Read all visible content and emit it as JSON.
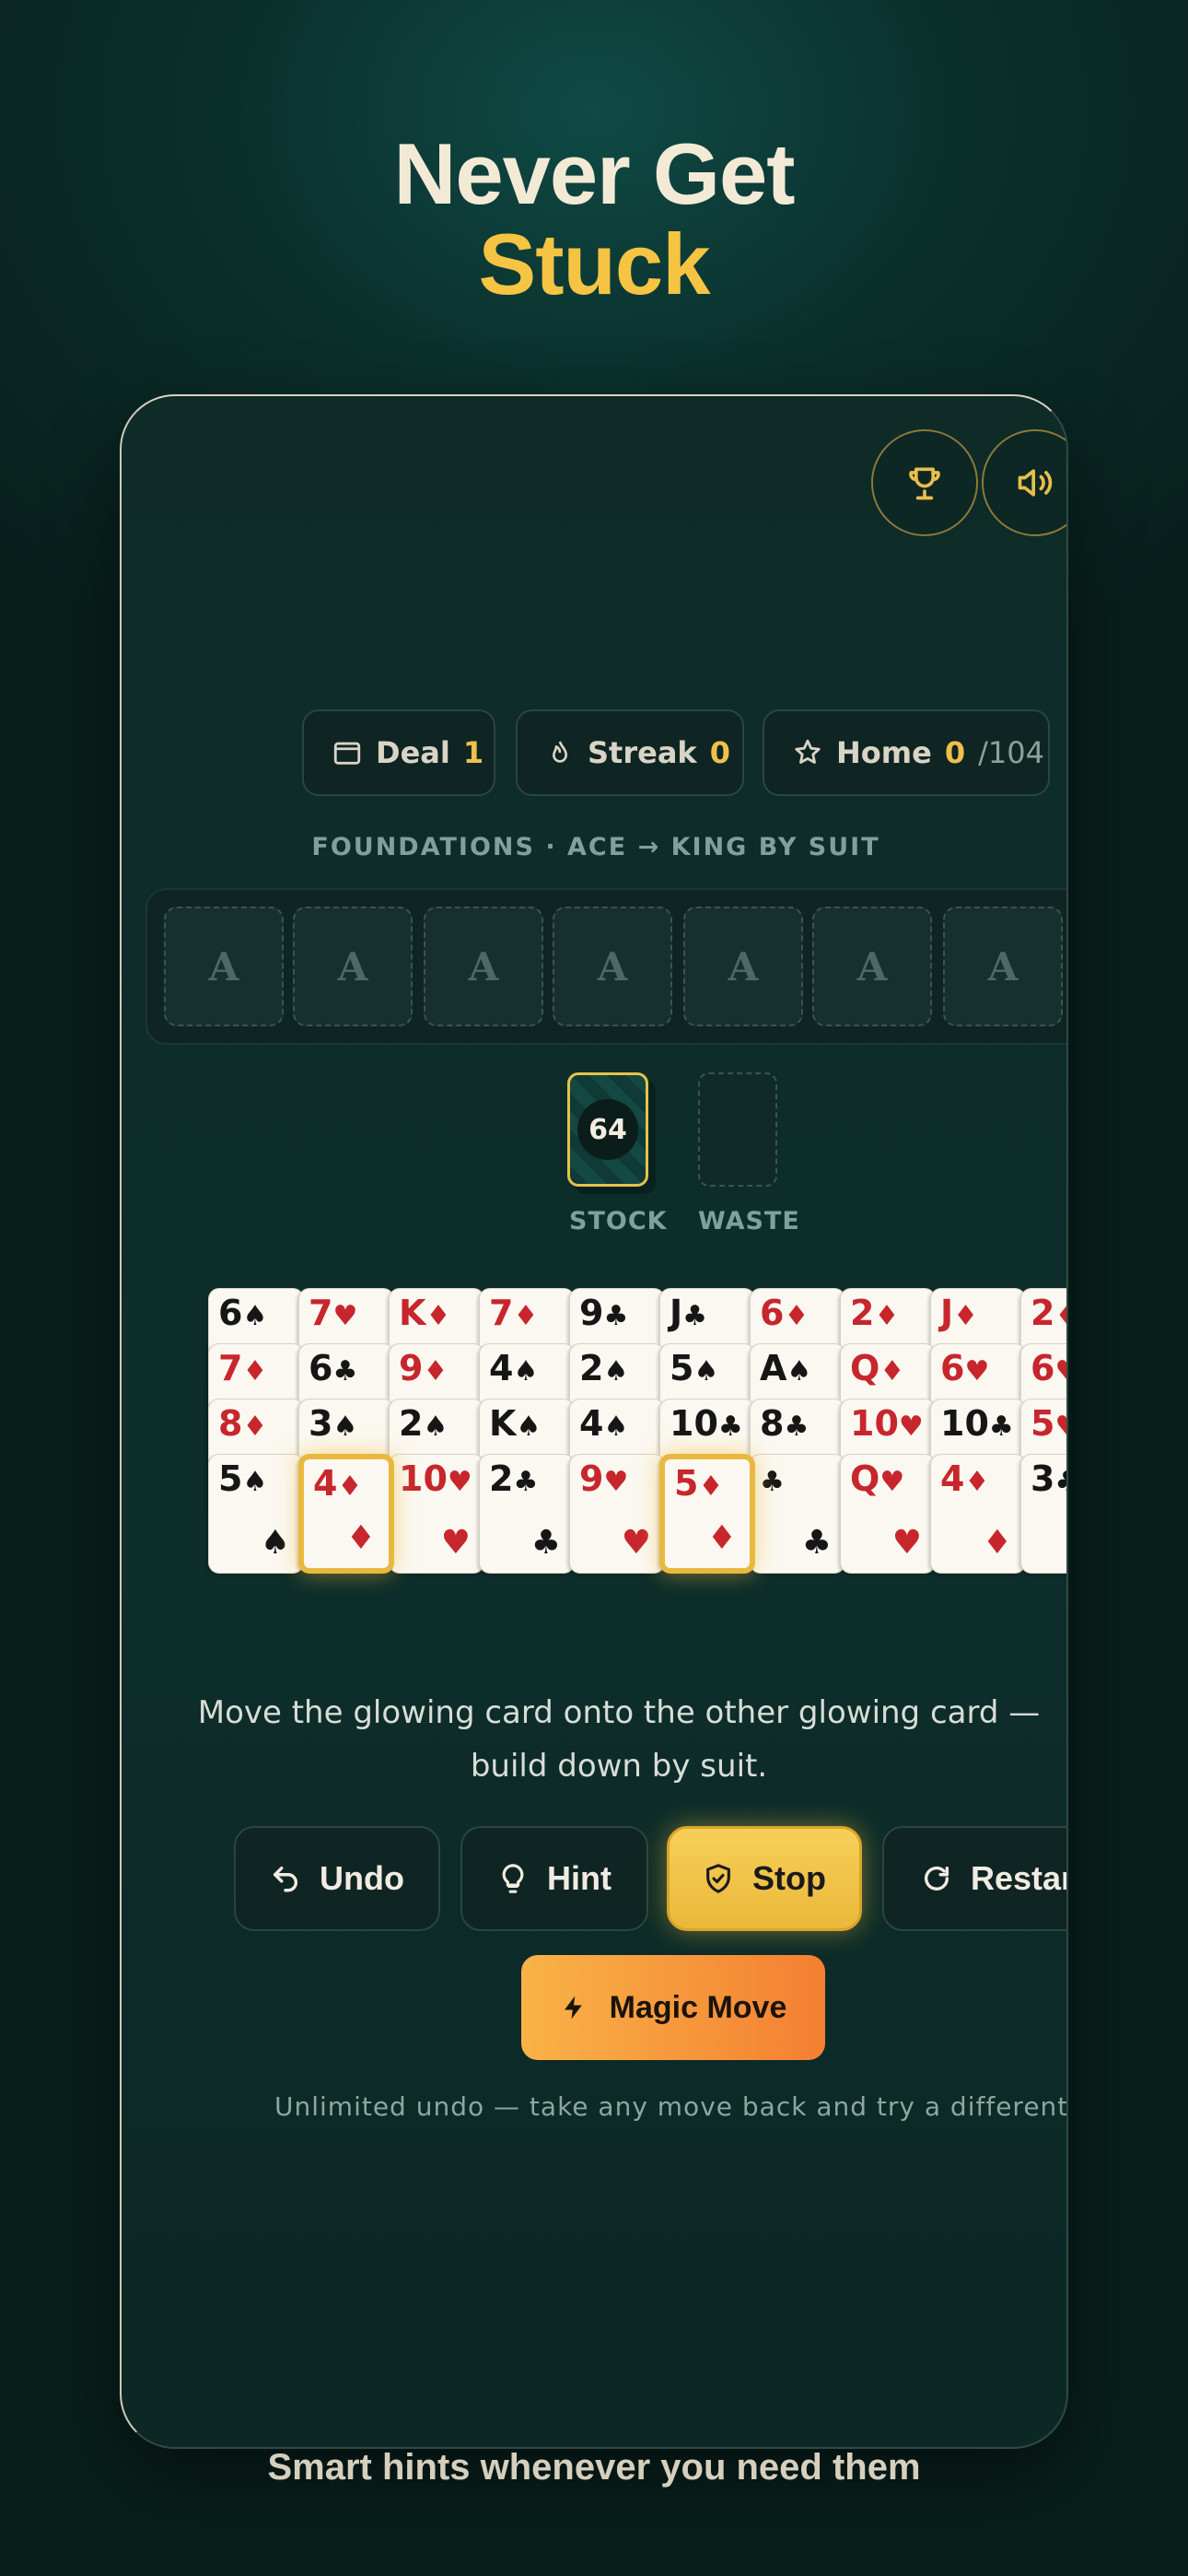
{
  "headline": {
    "line1": "Never Get",
    "line2": "Stuck"
  },
  "top_buttons": [
    {
      "name": "trophy-icon"
    },
    {
      "name": "speaker-icon"
    }
  ],
  "stats": {
    "deal": {
      "label": "Deal",
      "value": "1",
      "icon": "card-icon"
    },
    "streak": {
      "label": "Streak",
      "value": "0",
      "icon": "flame-icon"
    },
    "home": {
      "label": "Home",
      "value": "0",
      "total": "/104",
      "icon": "star-icon"
    }
  },
  "foundations": {
    "label": "FOUNDATIONS · ACE → KING BY SUIT",
    "slots": [
      "A",
      "A",
      "A",
      "A",
      "A",
      "A",
      "A"
    ]
  },
  "stock": {
    "count": "64",
    "label": "STOCK"
  },
  "waste": {
    "label": "WASTE"
  },
  "tableau": [
    {
      "cards": [
        {
          "rank": "6",
          "suit": "♠",
          "color": "black"
        },
        {
          "rank": "7",
          "suit": "♦",
          "color": "red"
        },
        {
          "rank": "8",
          "suit": "♦",
          "color": "red"
        },
        {
          "rank": "5",
          "suit": "♠",
          "color": "black"
        }
      ]
    },
    {
      "cards": [
        {
          "rank": "7",
          "suit": "♥",
          "color": "red"
        },
        {
          "rank": "6",
          "suit": "♣",
          "color": "black"
        },
        {
          "rank": "3",
          "suit": "♠",
          "color": "black"
        },
        {
          "rank": "4",
          "suit": "♦",
          "color": "red",
          "glow": true
        }
      ]
    },
    {
      "cards": [
        {
          "rank": "K",
          "suit": "♦",
          "color": "red"
        },
        {
          "rank": "9",
          "suit": "♦",
          "color": "red"
        },
        {
          "rank": "2",
          "suit": "♠",
          "color": "black"
        },
        {
          "rank": "10",
          "suit": "♥",
          "color": "red"
        }
      ]
    },
    {
      "cards": [
        {
          "rank": "7",
          "suit": "♦",
          "color": "red"
        },
        {
          "rank": "4",
          "suit": "♠",
          "color": "black"
        },
        {
          "rank": "K",
          "suit": "♠",
          "color": "black"
        },
        {
          "rank": "2",
          "suit": "♣",
          "color": "black"
        }
      ]
    },
    {
      "cards": [
        {
          "rank": "9",
          "suit": "♣",
          "color": "black"
        },
        {
          "rank": "2",
          "suit": "♠",
          "color": "black"
        },
        {
          "rank": "4",
          "suit": "♠",
          "color": "black"
        },
        {
          "rank": "9",
          "suit": "♥",
          "color": "red"
        }
      ]
    },
    {
      "cards": [
        {
          "rank": "J",
          "suit": "♣",
          "color": "black"
        },
        {
          "rank": "5",
          "suit": "♠",
          "color": "black"
        },
        {
          "rank": "10",
          "suit": "♣",
          "color": "black"
        },
        {
          "rank": "5",
          "suit": "♦",
          "color": "red",
          "glow": true
        }
      ]
    },
    {
      "cards": [
        {
          "rank": "6",
          "suit": "♦",
          "color": "red"
        },
        {
          "rank": "A",
          "suit": "♠",
          "color": "black"
        },
        {
          "rank": "8",
          "suit": "♣",
          "color": "black"
        },
        {
          "rank": "",
          "suit": "♣",
          "color": "black"
        }
      ]
    },
    {
      "cards": [
        {
          "rank": "2",
          "suit": "♦",
          "color": "red"
        },
        {
          "rank": "Q",
          "suit": "♦",
          "color": "red"
        },
        {
          "rank": "10",
          "suit": "♥",
          "color": "red"
        },
        {
          "rank": "Q",
          "suit": "♥",
          "color": "red"
        }
      ]
    },
    {
      "cards": [
        {
          "rank": "J",
          "suit": "♦",
          "color": "red"
        },
        {
          "rank": "6",
          "suit": "♥",
          "color": "red"
        },
        {
          "rank": "10",
          "suit": "♣",
          "color": "black"
        },
        {
          "rank": "4",
          "suit": "♦",
          "color": "red"
        }
      ]
    },
    {
      "cards": [
        {
          "rank": "2",
          "suit": "♦",
          "color": "red"
        },
        {
          "rank": "6",
          "suit": "♥",
          "color": "red"
        },
        {
          "rank": "5",
          "suit": "♥",
          "color": "red"
        },
        {
          "rank": "3",
          "suit": "♣",
          "color": "black"
        }
      ]
    }
  ],
  "hint_message": "Move the glowing card onto the other glowing card — build down by suit.",
  "controls": {
    "undo": "Undo",
    "hint": "Hint",
    "stop": "Stop",
    "restart": "Restart",
    "magic": "Magic Move"
  },
  "footnote": "Unlimited undo — take any move back and try a different line.",
  "caption": "Smart hints whenever you need them",
  "colors": {
    "accent": "#f5c443",
    "background": "#0b2f2b",
    "magic": "#f7934a"
  }
}
